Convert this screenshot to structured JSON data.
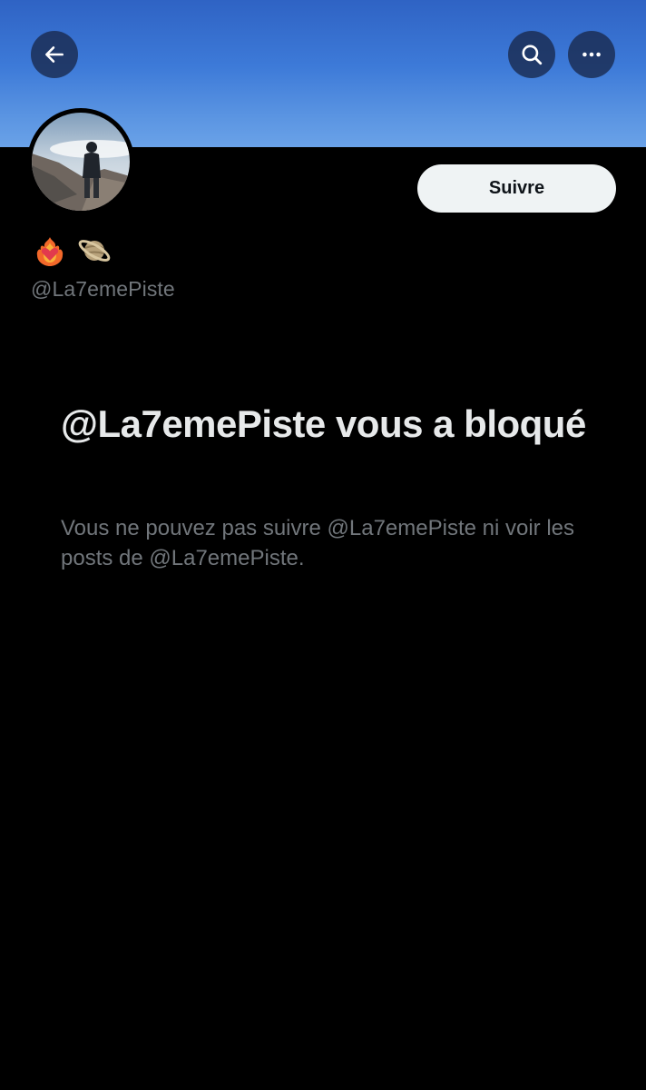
{
  "header": {
    "back_icon": "arrow-left-icon",
    "search_icon": "search-icon",
    "more_icon": "more-horizontal-icon",
    "banner_color": "#3d7ad8"
  },
  "profile": {
    "avatar_alt": "avatar-photo",
    "follow_label": "Suivre",
    "name_emojis": [
      "heart-on-fire-icon",
      "ringed-planet-icon"
    ],
    "handle": "@La7emePiste"
  },
  "blocked": {
    "title": "@La7emePiste vous a bloqué",
    "description": "Vous ne pouvez pas suivre @La7emePiste ni voir les posts de @La7emePiste."
  },
  "colors": {
    "background": "#000000",
    "primary_text": "#e7e9ea",
    "secondary_text": "#71767b",
    "button_bg": "#eff3f4",
    "button_text": "#0f1419"
  }
}
